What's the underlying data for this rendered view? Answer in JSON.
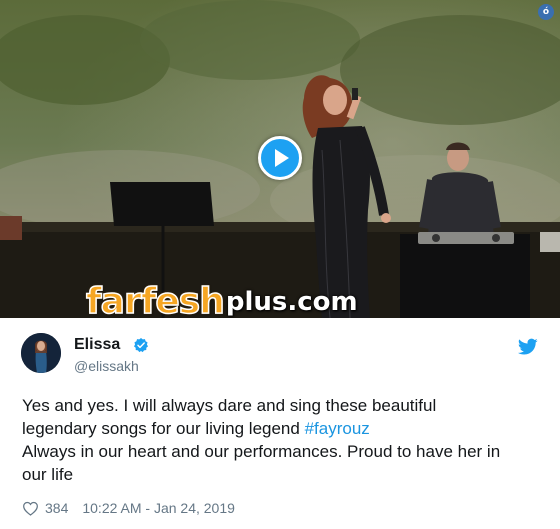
{
  "video": {
    "corner_badge": "ó",
    "watermark_main": "farfesh",
    "watermark_suffix": "plus.com"
  },
  "tweet": {
    "display_name": "Elissa",
    "handle": "@elissakh",
    "text_line1": "Yes and yes. I will always dare and sing these beautiful",
    "text_line2_prefix": "legendary songs for our living legend ",
    "hashtag": "#fayrouz",
    "text_line3": "Always in our heart and our performances. Proud to have her in",
    "text_line4": "our life",
    "like_count": "384",
    "timestamp": "10:22 AM - Jan 24, 2019"
  },
  "icons": {
    "play": "play-icon",
    "verified": "verified-badge-icon",
    "twitter": "twitter-bird-icon",
    "like": "heart-icon"
  },
  "colors": {
    "twitter_blue": "#1da1f2",
    "hashtag": "#1b95e0",
    "watermark_orange": "#f6a623",
    "muted_text": "#657786"
  }
}
